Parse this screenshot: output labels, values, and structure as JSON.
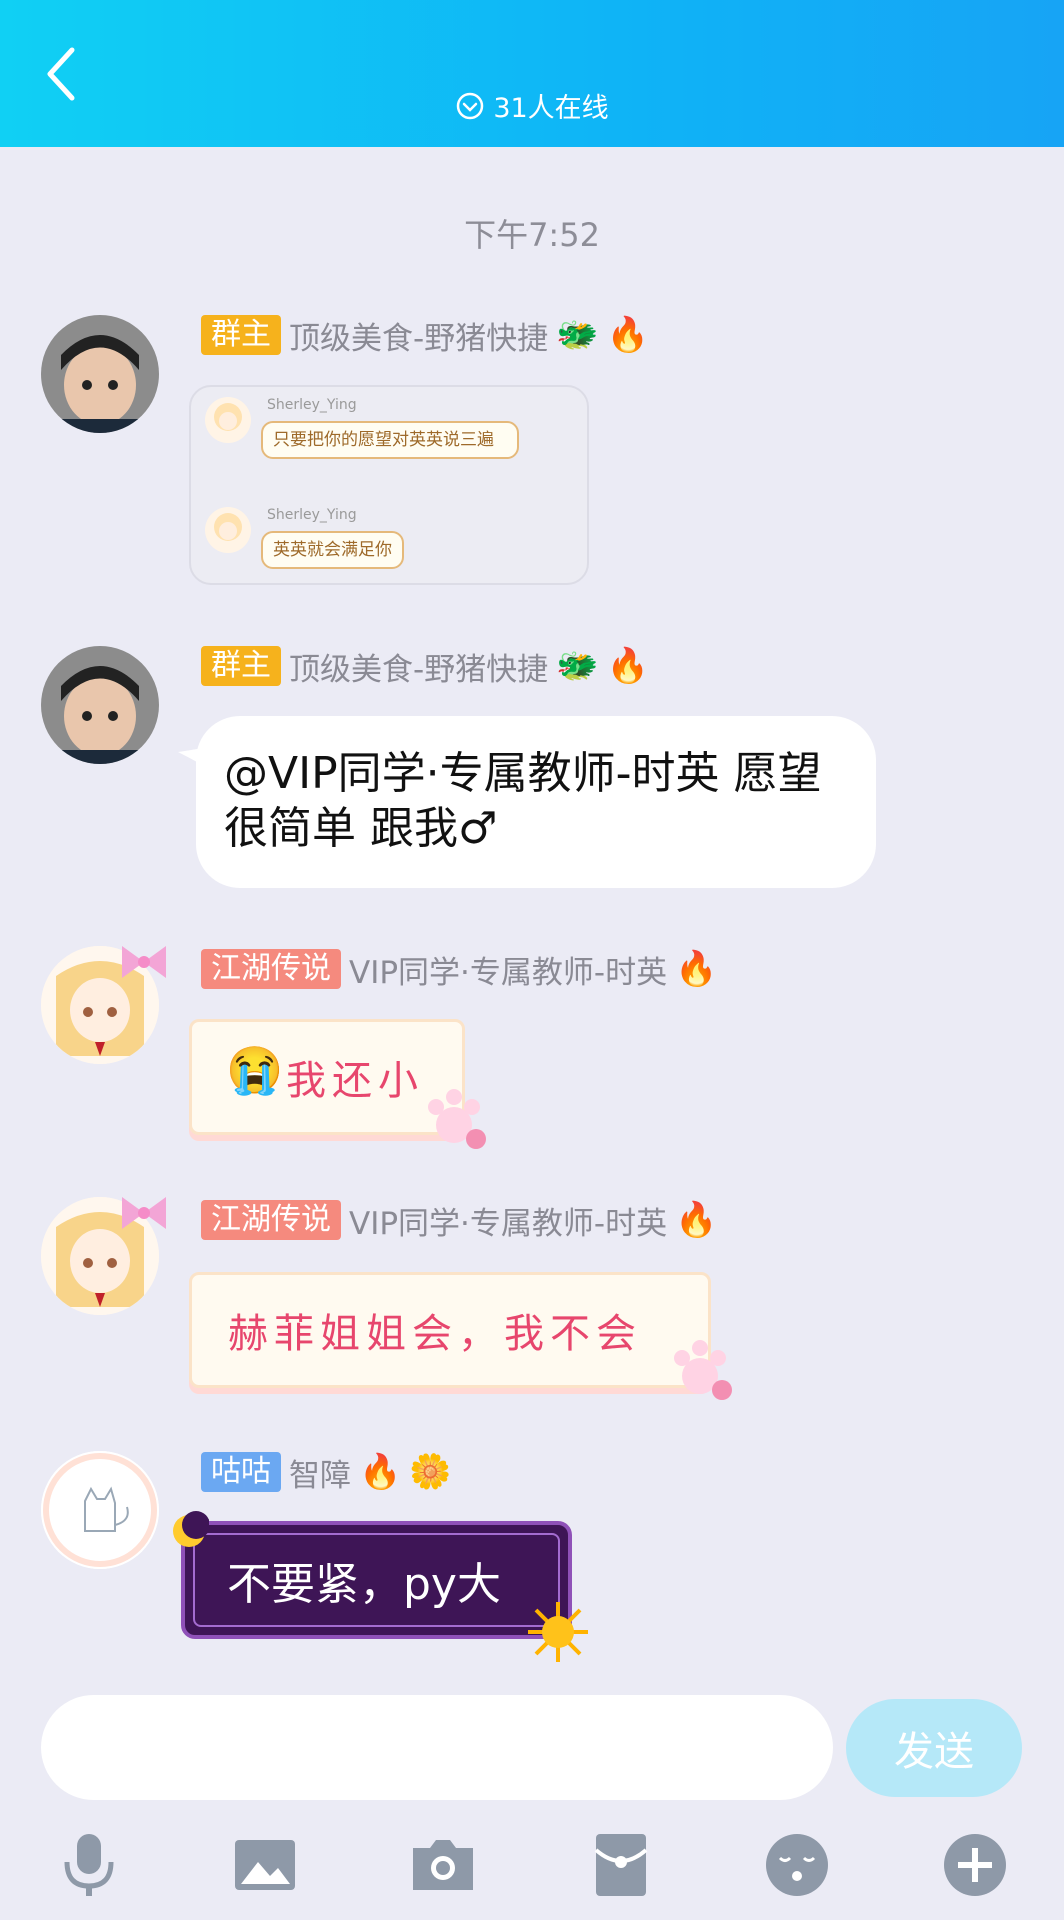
{
  "header": {
    "online_text": "31人在线",
    "bg_color": "#0fb3f6"
  },
  "time_divider": "下午7:52",
  "messages": [
    {
      "badge": "群主",
      "nickname": "顶级美食-野猪快捷",
      "quote": {
        "items": [
          {
            "name": "Sherley_Ying",
            "text": "只要把你的愿望对英英说三遍"
          },
          {
            "name": "Sherley_Ying",
            "text": "英英就会满足你"
          }
        ]
      }
    },
    {
      "badge": "群主",
      "nickname": "顶级美食-野猪快捷",
      "text": "@VIP同学·专属教师-时英 愿望很简单 跟我♂"
    },
    {
      "badge": "江湖传说",
      "nickname": "VIP同学·专属教师-时英",
      "text": "我还小"
    },
    {
      "badge": "江湖传说",
      "nickname": "VIP同学·专属教师-时英",
      "text": "赫菲姐姐会，我不会"
    },
    {
      "badge": "咕咕",
      "nickname": "智障",
      "text": "不要紧，py大"
    }
  ],
  "composer": {
    "send_label": "发送"
  },
  "toolbar": [
    "microphone-icon",
    "image-icon",
    "camera-icon",
    "red-packet-icon",
    "emoji-icon",
    "plus-icon"
  ]
}
